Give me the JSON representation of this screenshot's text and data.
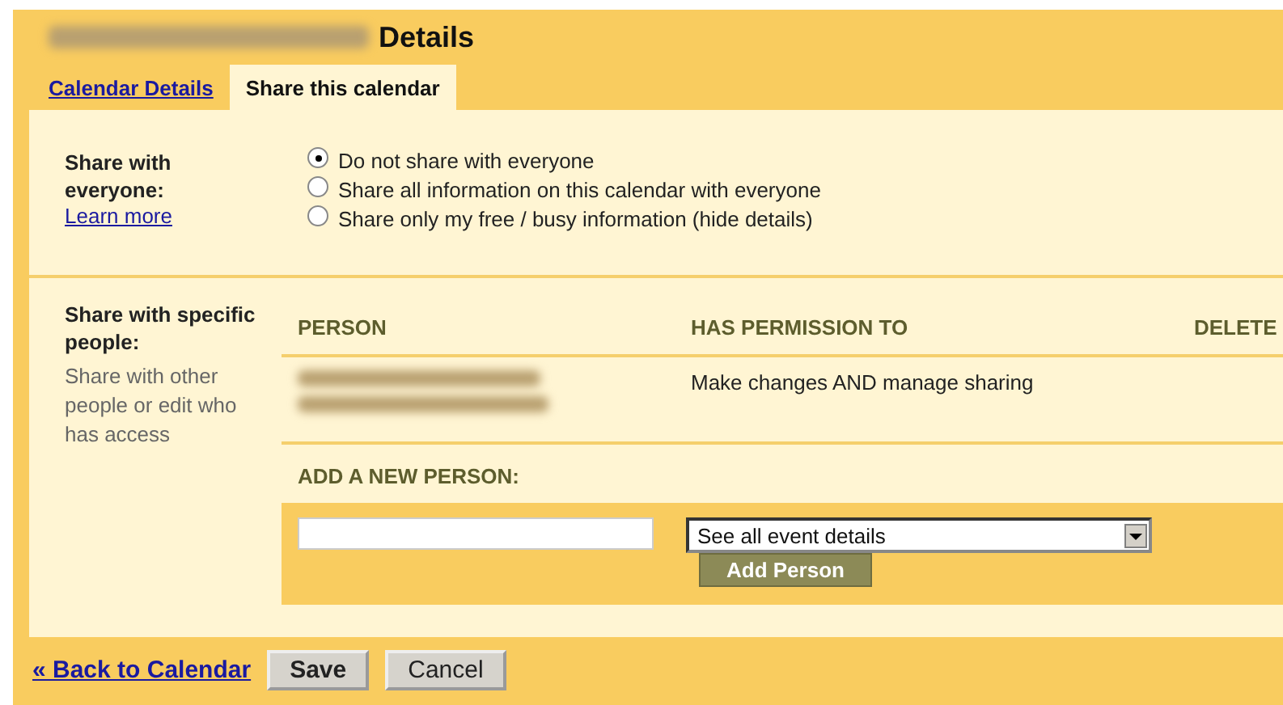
{
  "header": {
    "title": "Details"
  },
  "tabs": [
    {
      "label": "Calendar Details",
      "selected": false
    },
    {
      "label": "Share this calendar",
      "selected": true
    }
  ],
  "share_everyone": {
    "label": "Share with everyone:",
    "link": "Learn more",
    "options": [
      {
        "label": "Do not share with everyone",
        "selected": true
      },
      {
        "label": "Share all information on this calendar with everyone",
        "selected": false
      },
      {
        "label": "Share only my free / busy information (hide details)",
        "selected": false
      }
    ]
  },
  "share_specific": {
    "label": "Share with specific people:",
    "hint": "Share with other people or edit who has access",
    "columns": [
      "PERSON",
      "HAS PERMISSION TO",
      "DELETE"
    ],
    "rows": [
      {
        "permission": "Make changes AND manage sharing"
      }
    ],
    "add_label": "ADD A NEW PERSON:",
    "permission_select": "See all event details",
    "add_button": "Add Person"
  },
  "footer": {
    "back_link": "« Back to Calendar",
    "buttons": [
      "Save",
      "Cancel"
    ]
  }
}
